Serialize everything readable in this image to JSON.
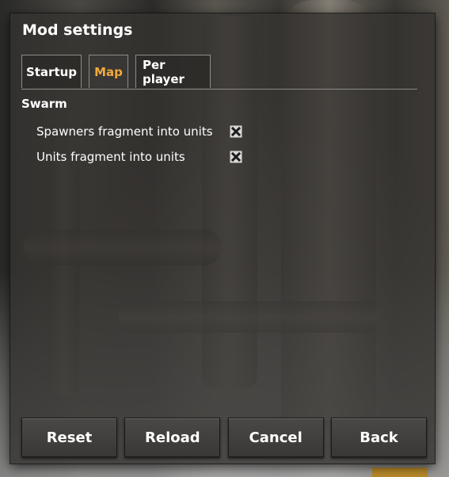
{
  "dialog": {
    "title": "Mod settings"
  },
  "tabs": [
    {
      "label": "Startup",
      "active": false
    },
    {
      "label": "Map",
      "active": true
    },
    {
      "label": "Per player",
      "active": false
    }
  ],
  "section": {
    "title": "Swarm",
    "settings": [
      {
        "label": "Spawners fragment into units",
        "checked": true
      },
      {
        "label": "Units fragment into units",
        "checked": true
      }
    ]
  },
  "buttons": {
    "reset": "Reset",
    "reload": "Reload",
    "cancel": "Cancel",
    "back": "Back"
  },
  "colors": {
    "active_tab": "#f2a93b",
    "text": "#ffffff"
  },
  "icons": {
    "checkbox_mark": "x-mark-icon"
  }
}
